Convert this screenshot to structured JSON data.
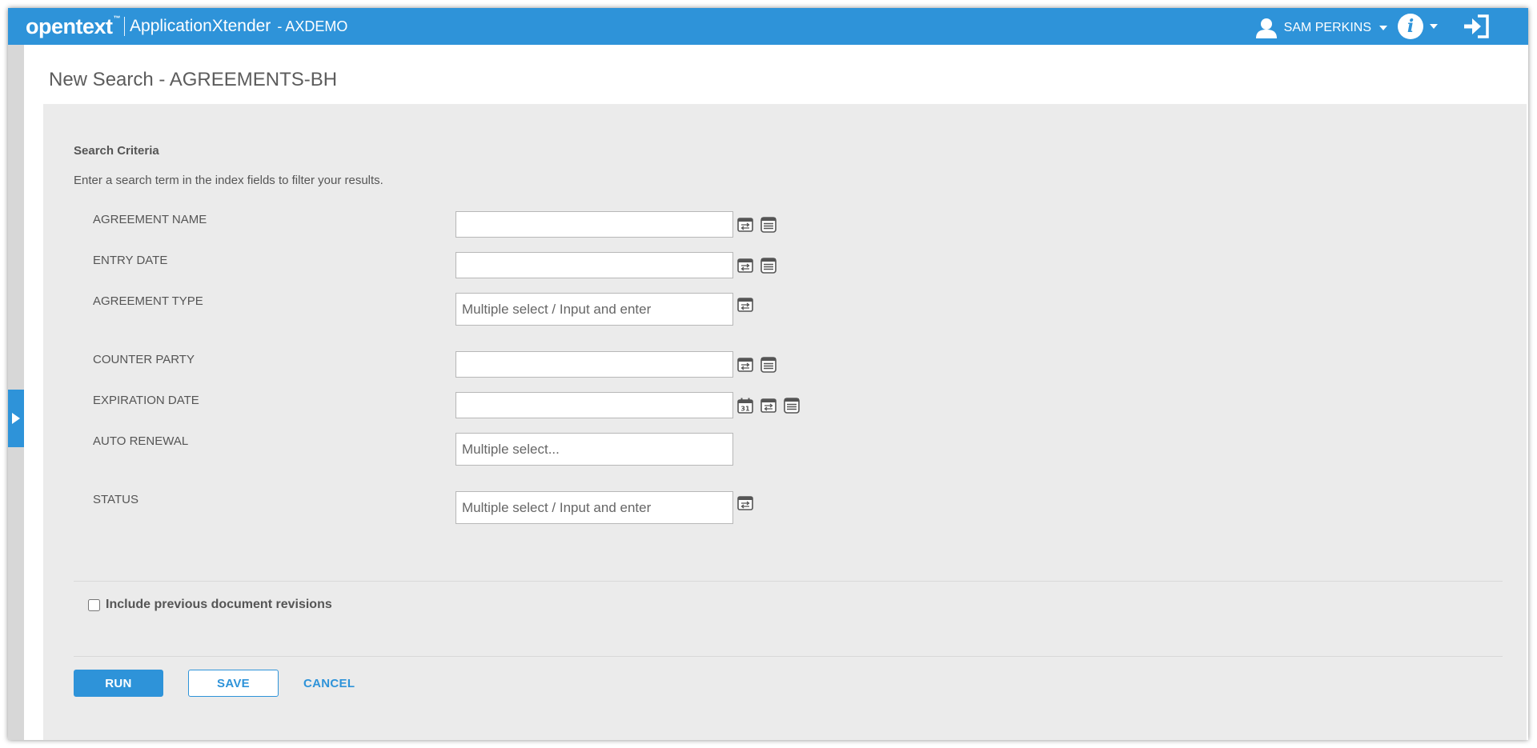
{
  "app": {
    "brand": "opentext",
    "trademark": "™",
    "product": "ApplicationXtender",
    "repository": "- AXDEMO",
    "accent_color": "#2e93d9"
  },
  "header": {
    "user_name": "SAM PERKINS",
    "info_glyph": "i",
    "icons": [
      "user-icon",
      "info-icon",
      "logout-icon"
    ]
  },
  "page": {
    "title": "New Search - AGREEMENTS-BH"
  },
  "criteria": {
    "title": "Search Criteria",
    "description": "Enter a search term in the index fields to filter your results.",
    "fields": [
      {
        "label": "AGREEMENT NAME",
        "placeholder": "",
        "icons": [
          "operator-icon",
          "list-icon"
        ]
      },
      {
        "label": "ENTRY DATE",
        "placeholder": "",
        "icons": [
          "operator-icon",
          "list-icon"
        ]
      },
      {
        "label": "AGREEMENT TYPE",
        "placeholder": "Multiple select / Input and enter",
        "icons": [
          "operator-icon"
        ]
      },
      {
        "label": "COUNTER PARTY",
        "placeholder": "",
        "icons": [
          "operator-icon",
          "list-icon"
        ]
      },
      {
        "label": "EXPIRATION DATE",
        "placeholder": "",
        "icons": [
          "calendar-icon",
          "operator-icon",
          "list-icon"
        ],
        "calendar_day": "31"
      },
      {
        "label": "AUTO RENEWAL",
        "placeholder": "Multiple select...",
        "icons": []
      },
      {
        "label": "STATUS",
        "placeholder": "Multiple select / Input and enter",
        "icons": [
          "operator-icon"
        ]
      }
    ]
  },
  "options": {
    "include_revisions_label": "Include previous document revisions",
    "include_revisions_checked": false
  },
  "actions": {
    "run": "RUN",
    "save": "SAVE",
    "cancel": "CANCEL"
  }
}
